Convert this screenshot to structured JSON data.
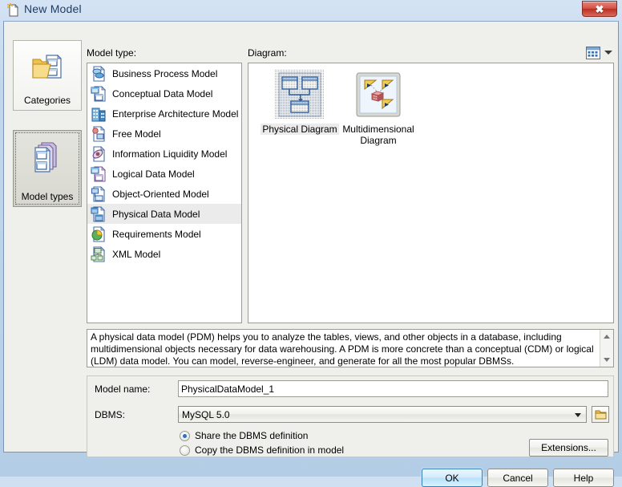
{
  "window": {
    "title": "New Model",
    "title_icon": "new-document-icon",
    "close_label": "✖"
  },
  "rail": {
    "items": [
      {
        "label": "Categories",
        "icon": "folder-documents-icon",
        "selected": false
      },
      {
        "label": "Model types",
        "icon": "stacked-documents-icon",
        "selected": true
      }
    ]
  },
  "labels": {
    "model_type": "Model type:",
    "diagram": "Diagram:"
  },
  "model_types": {
    "items": [
      {
        "label": "Business Process Model",
        "icon": "business-process-model-icon",
        "selected": false
      },
      {
        "label": "Conceptual Data Model",
        "icon": "conceptual-data-model-icon",
        "selected": false
      },
      {
        "label": "Enterprise Architecture Model",
        "icon": "enterprise-architecture-model-icon",
        "selected": false
      },
      {
        "label": "Free Model",
        "icon": "free-model-icon",
        "selected": false
      },
      {
        "label": "Information Liquidity Model",
        "icon": "information-liquidity-model-icon",
        "selected": false
      },
      {
        "label": "Logical Data Model",
        "icon": "logical-data-model-icon",
        "selected": false
      },
      {
        "label": "Object-Oriented Model",
        "icon": "object-oriented-model-icon",
        "selected": false
      },
      {
        "label": "Physical Data Model",
        "icon": "physical-data-model-icon",
        "selected": true
      },
      {
        "label": "Requirements Model",
        "icon": "requirements-model-icon",
        "selected": false
      },
      {
        "label": "XML Model",
        "icon": "xml-model-icon",
        "selected": false
      }
    ]
  },
  "diagram": {
    "view_mode_icon": "list-view-icon",
    "view_mode_dropdown_icon": "chevron-down-icon",
    "items": [
      {
        "label": "Physical Diagram",
        "icon": "physical-diagram-icon",
        "selected": true
      },
      {
        "label": "Multidimensional Diagram",
        "icon": "multidimensional-diagram-icon",
        "selected": false
      }
    ]
  },
  "description": {
    "text": "A physical data model (PDM) helps you to analyze the tables, views, and other objects in a database, including multidimensional objects necessary for data warehousing. A PDM is more concrete than a conceptual (CDM) or logical (LDM) data model. You can model, reverse-engineer, and generate for all the most popular DBMSs."
  },
  "form": {
    "model_name_label": "Model name:",
    "model_name_value": "PhysicalDataModel_1",
    "dbms_label": "DBMS:",
    "dbms_value": "MySQL 5.0",
    "dbms_browse_icon": "folder-icon",
    "radio_share_label": "Share the DBMS definition",
    "radio_copy_label": "Copy the DBMS definition in model",
    "radio_selected": "share",
    "extensions_label": "Extensions..."
  },
  "footer": {
    "ok_label": "OK",
    "cancel_label": "Cancel",
    "help_label": "Help"
  },
  "colors": {
    "accent": "#2f6fbe",
    "close_red": "#bb2e22",
    "titlebar": "#cfe0f2",
    "dialog_bg": "#efefeb"
  }
}
